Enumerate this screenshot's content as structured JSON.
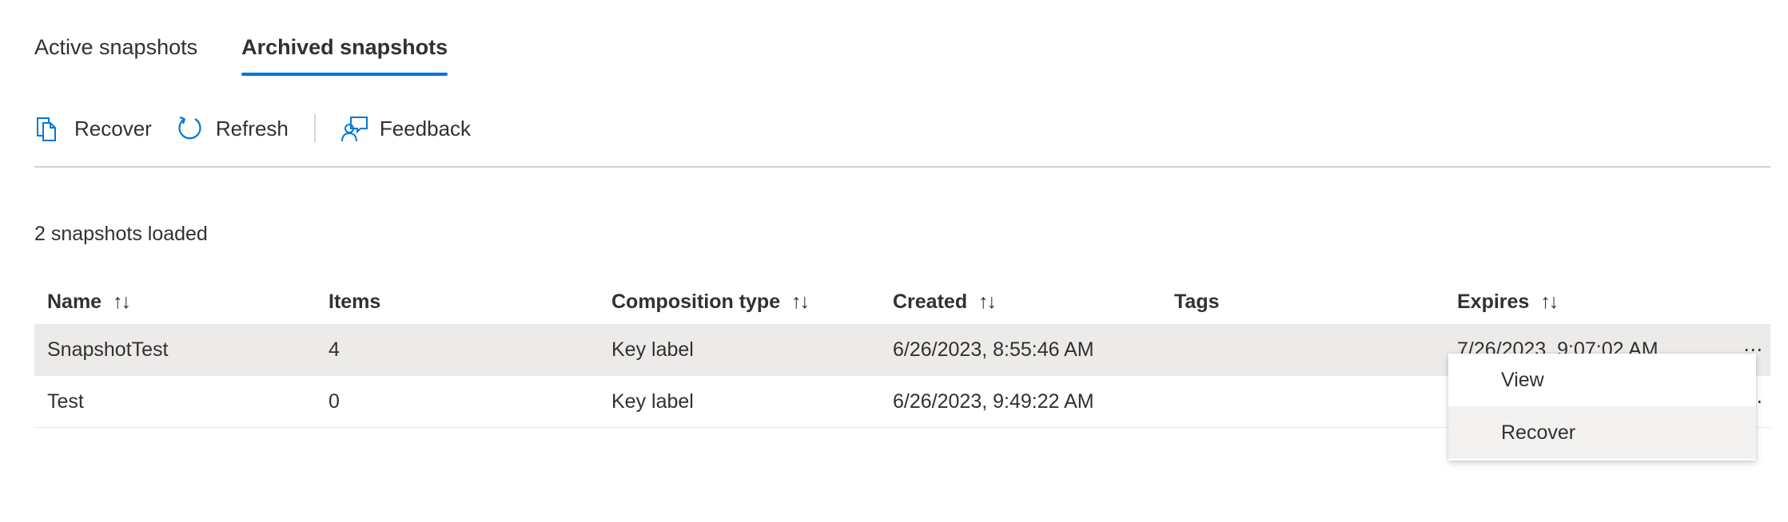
{
  "tabs": [
    {
      "label": "Active snapshots",
      "active": false
    },
    {
      "label": "Archived snapshots",
      "active": true
    }
  ],
  "toolbar": {
    "recover_label": "Recover",
    "refresh_label": "Refresh",
    "feedback_label": "Feedback"
  },
  "status": "2 snapshots loaded",
  "table": {
    "columns": [
      "Name",
      "Items",
      "Composition type",
      "Created",
      "Tags",
      "Expires"
    ],
    "sort_glyph": "↑↓",
    "rows": [
      {
        "name": "SnapshotTest",
        "items": "4",
        "composition": "Key label",
        "created": "6/26/2023, 8:55:46 AM",
        "tags": "",
        "expires": "7/26/2023, 9:07:02 AM"
      },
      {
        "name": "Test",
        "items": "0",
        "composition": "Key label",
        "created": "6/26/2023, 9:49:22 AM",
        "tags": "",
        "expires": ""
      }
    ]
  },
  "context_menu": {
    "items": [
      "View",
      "Recover"
    ]
  },
  "colors": {
    "accent": "#0078d4",
    "selected_row": "#edebe9",
    "text": "#323130"
  }
}
